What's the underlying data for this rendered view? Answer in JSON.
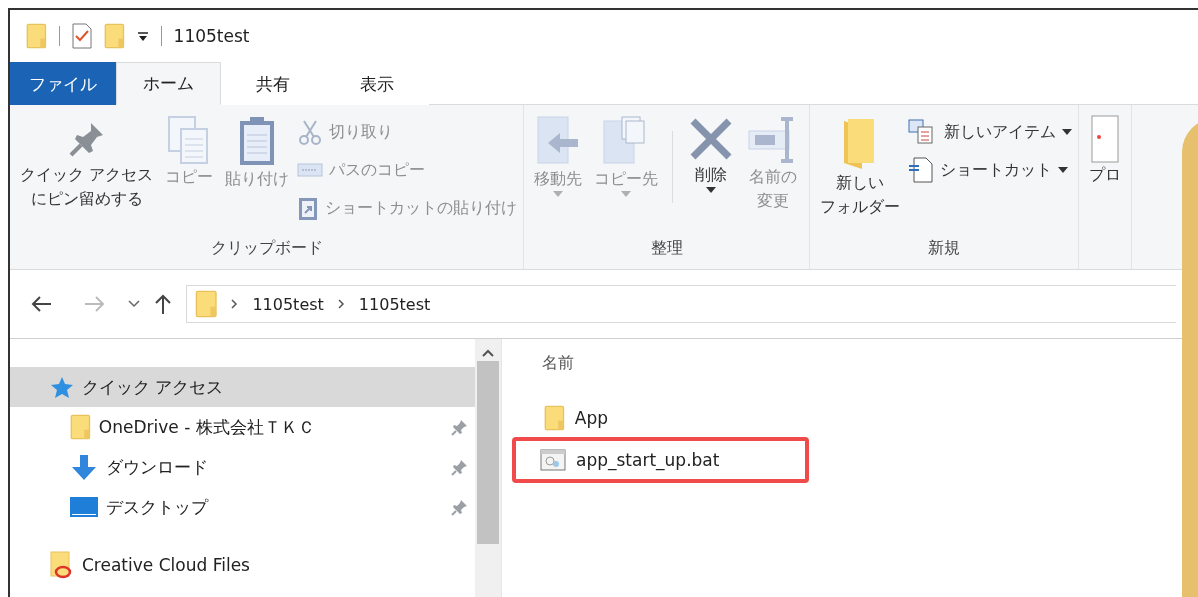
{
  "window": {
    "title": "1105test"
  },
  "tabs": [
    {
      "label": "ファイル",
      "kind": "file",
      "selected": false
    },
    {
      "label": "ホーム",
      "kind": "tab",
      "selected": true
    },
    {
      "label": "共有",
      "kind": "tab",
      "selected": false
    },
    {
      "label": "表示",
      "kind": "tab",
      "selected": false
    }
  ],
  "ribbon": {
    "groups": [
      {
        "label": "クリップボード",
        "items": [
          {
            "kind": "large",
            "lines": [
              "クイック アクセス",
              "にピン留めする"
            ],
            "disabled": false,
            "dropdown": false
          },
          {
            "kind": "large",
            "lines": [
              "コピー"
            ],
            "disabled": true,
            "dropdown": false
          },
          {
            "kind": "large",
            "lines": [
              "貼り付け"
            ],
            "disabled": true,
            "dropdown": false
          },
          {
            "kind": "stack",
            "items": [
              {
                "label": "切り取り",
                "disabled": true,
                "dropdown": false
              },
              {
                "label": "パスのコピー",
                "disabled": true,
                "dropdown": false
              },
              {
                "label": "ショートカットの貼り付け",
                "disabled": true,
                "dropdown": false
              }
            ]
          }
        ]
      },
      {
        "label": "整理",
        "items": [
          {
            "kind": "large",
            "lines": [
              "移動先"
            ],
            "disabled": true,
            "dropdown": true
          },
          {
            "kind": "large",
            "lines": [
              "コピー先"
            ],
            "disabled": true,
            "dropdown": true
          },
          {
            "kind": "separator"
          },
          {
            "kind": "large",
            "lines": [
              "削除"
            ],
            "disabled": false,
            "dropdown": true
          },
          {
            "kind": "large",
            "lines": [
              "名前の",
              "変更"
            ],
            "disabled": true,
            "dropdown": false
          }
        ]
      },
      {
        "label": "新規",
        "items": [
          {
            "kind": "large",
            "lines": [
              "新しい",
              "フォルダー"
            ],
            "disabled": false,
            "dropdown": false
          },
          {
            "kind": "stack",
            "items": [
              {
                "label": "新しいアイテム",
                "disabled": false,
                "dropdown": true
              },
              {
                "label": "ショートカット",
                "disabled": false,
                "dropdown": true
              }
            ]
          }
        ]
      },
      {
        "items": [
          {
            "kind": "large",
            "lines": [
              "プロ"
            ],
            "disabled": false,
            "dropdown": false
          }
        ]
      }
    ]
  },
  "address": {
    "path": [
      "1105test",
      "1105test"
    ]
  },
  "navigation": {
    "items": [
      {
        "label": "クイック アクセス",
        "selected": true,
        "children": [
          {
            "label": "OneDrive - 株式会社ＴＫＣ",
            "selected": false,
            "pinned": true
          },
          {
            "label": "ダウンロード",
            "selected": false,
            "pinned": true
          },
          {
            "label": "デスクトップ",
            "selected": false,
            "pinned": true
          }
        ]
      },
      {
        "label": "Creative Cloud Files",
        "selected": false
      }
    ]
  },
  "content": {
    "column": "名前",
    "files": [
      {
        "name": "App",
        "kind": "folder",
        "highlighted": false
      },
      {
        "name": "app_start_up.bat",
        "kind": "bat",
        "highlighted": true
      }
    ]
  }
}
